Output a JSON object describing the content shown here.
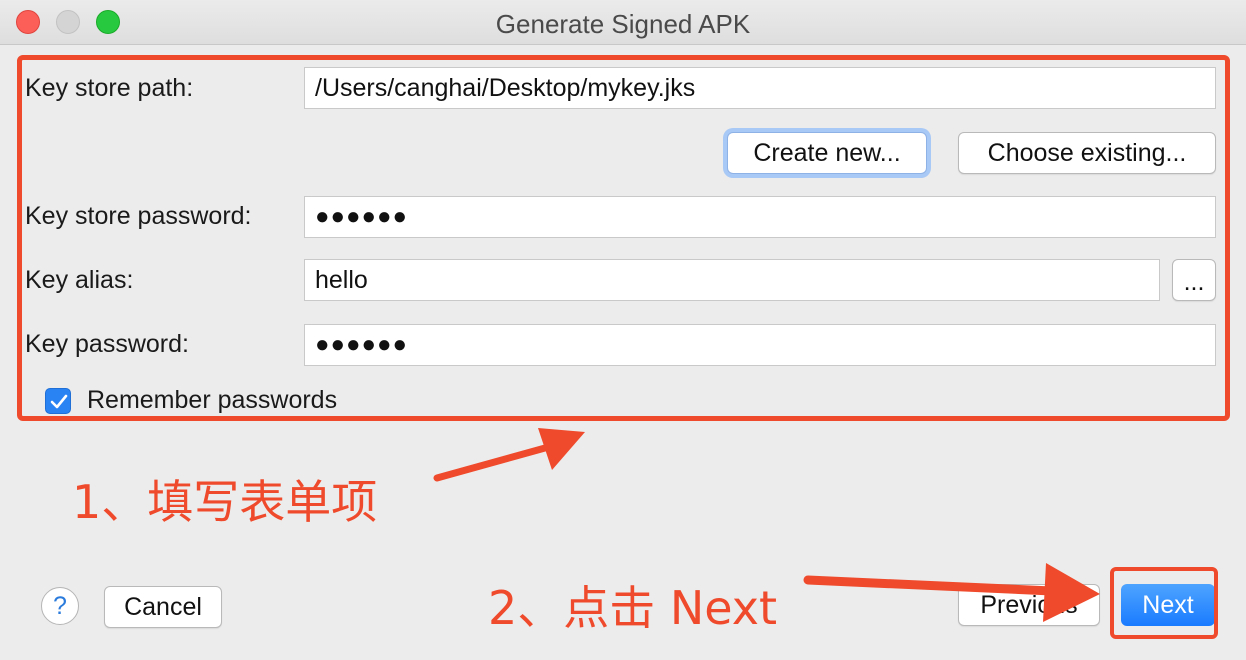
{
  "window": {
    "title": "Generate Signed APK"
  },
  "form": {
    "key_store_path_label": "Key store path:",
    "key_store_path_value": "/Users/canghai/Desktop/mykey.jks",
    "create_new_label": "Create new...",
    "choose_existing_label": "Choose existing...",
    "key_store_password_label": "Key store password:",
    "key_store_password_value": "●●●●●●",
    "key_alias_label": "Key alias:",
    "key_alias_value": "hello",
    "key_alias_browse_label": "...",
    "key_password_label": "Key password:",
    "key_password_value": "●●●●●●",
    "remember_label": "Remember passwords",
    "remember_checked": true
  },
  "footer": {
    "help_label": "?",
    "cancel_label": "Cancel",
    "previous_label": "Previous",
    "next_label": "Next"
  },
  "annotations": {
    "step1": "1、填写表单项",
    "step2": "2、点击 Next",
    "color": "#ef4a2b"
  },
  "colors": {
    "accent": "#1a7bff",
    "annotation": "#ef4a2b"
  }
}
